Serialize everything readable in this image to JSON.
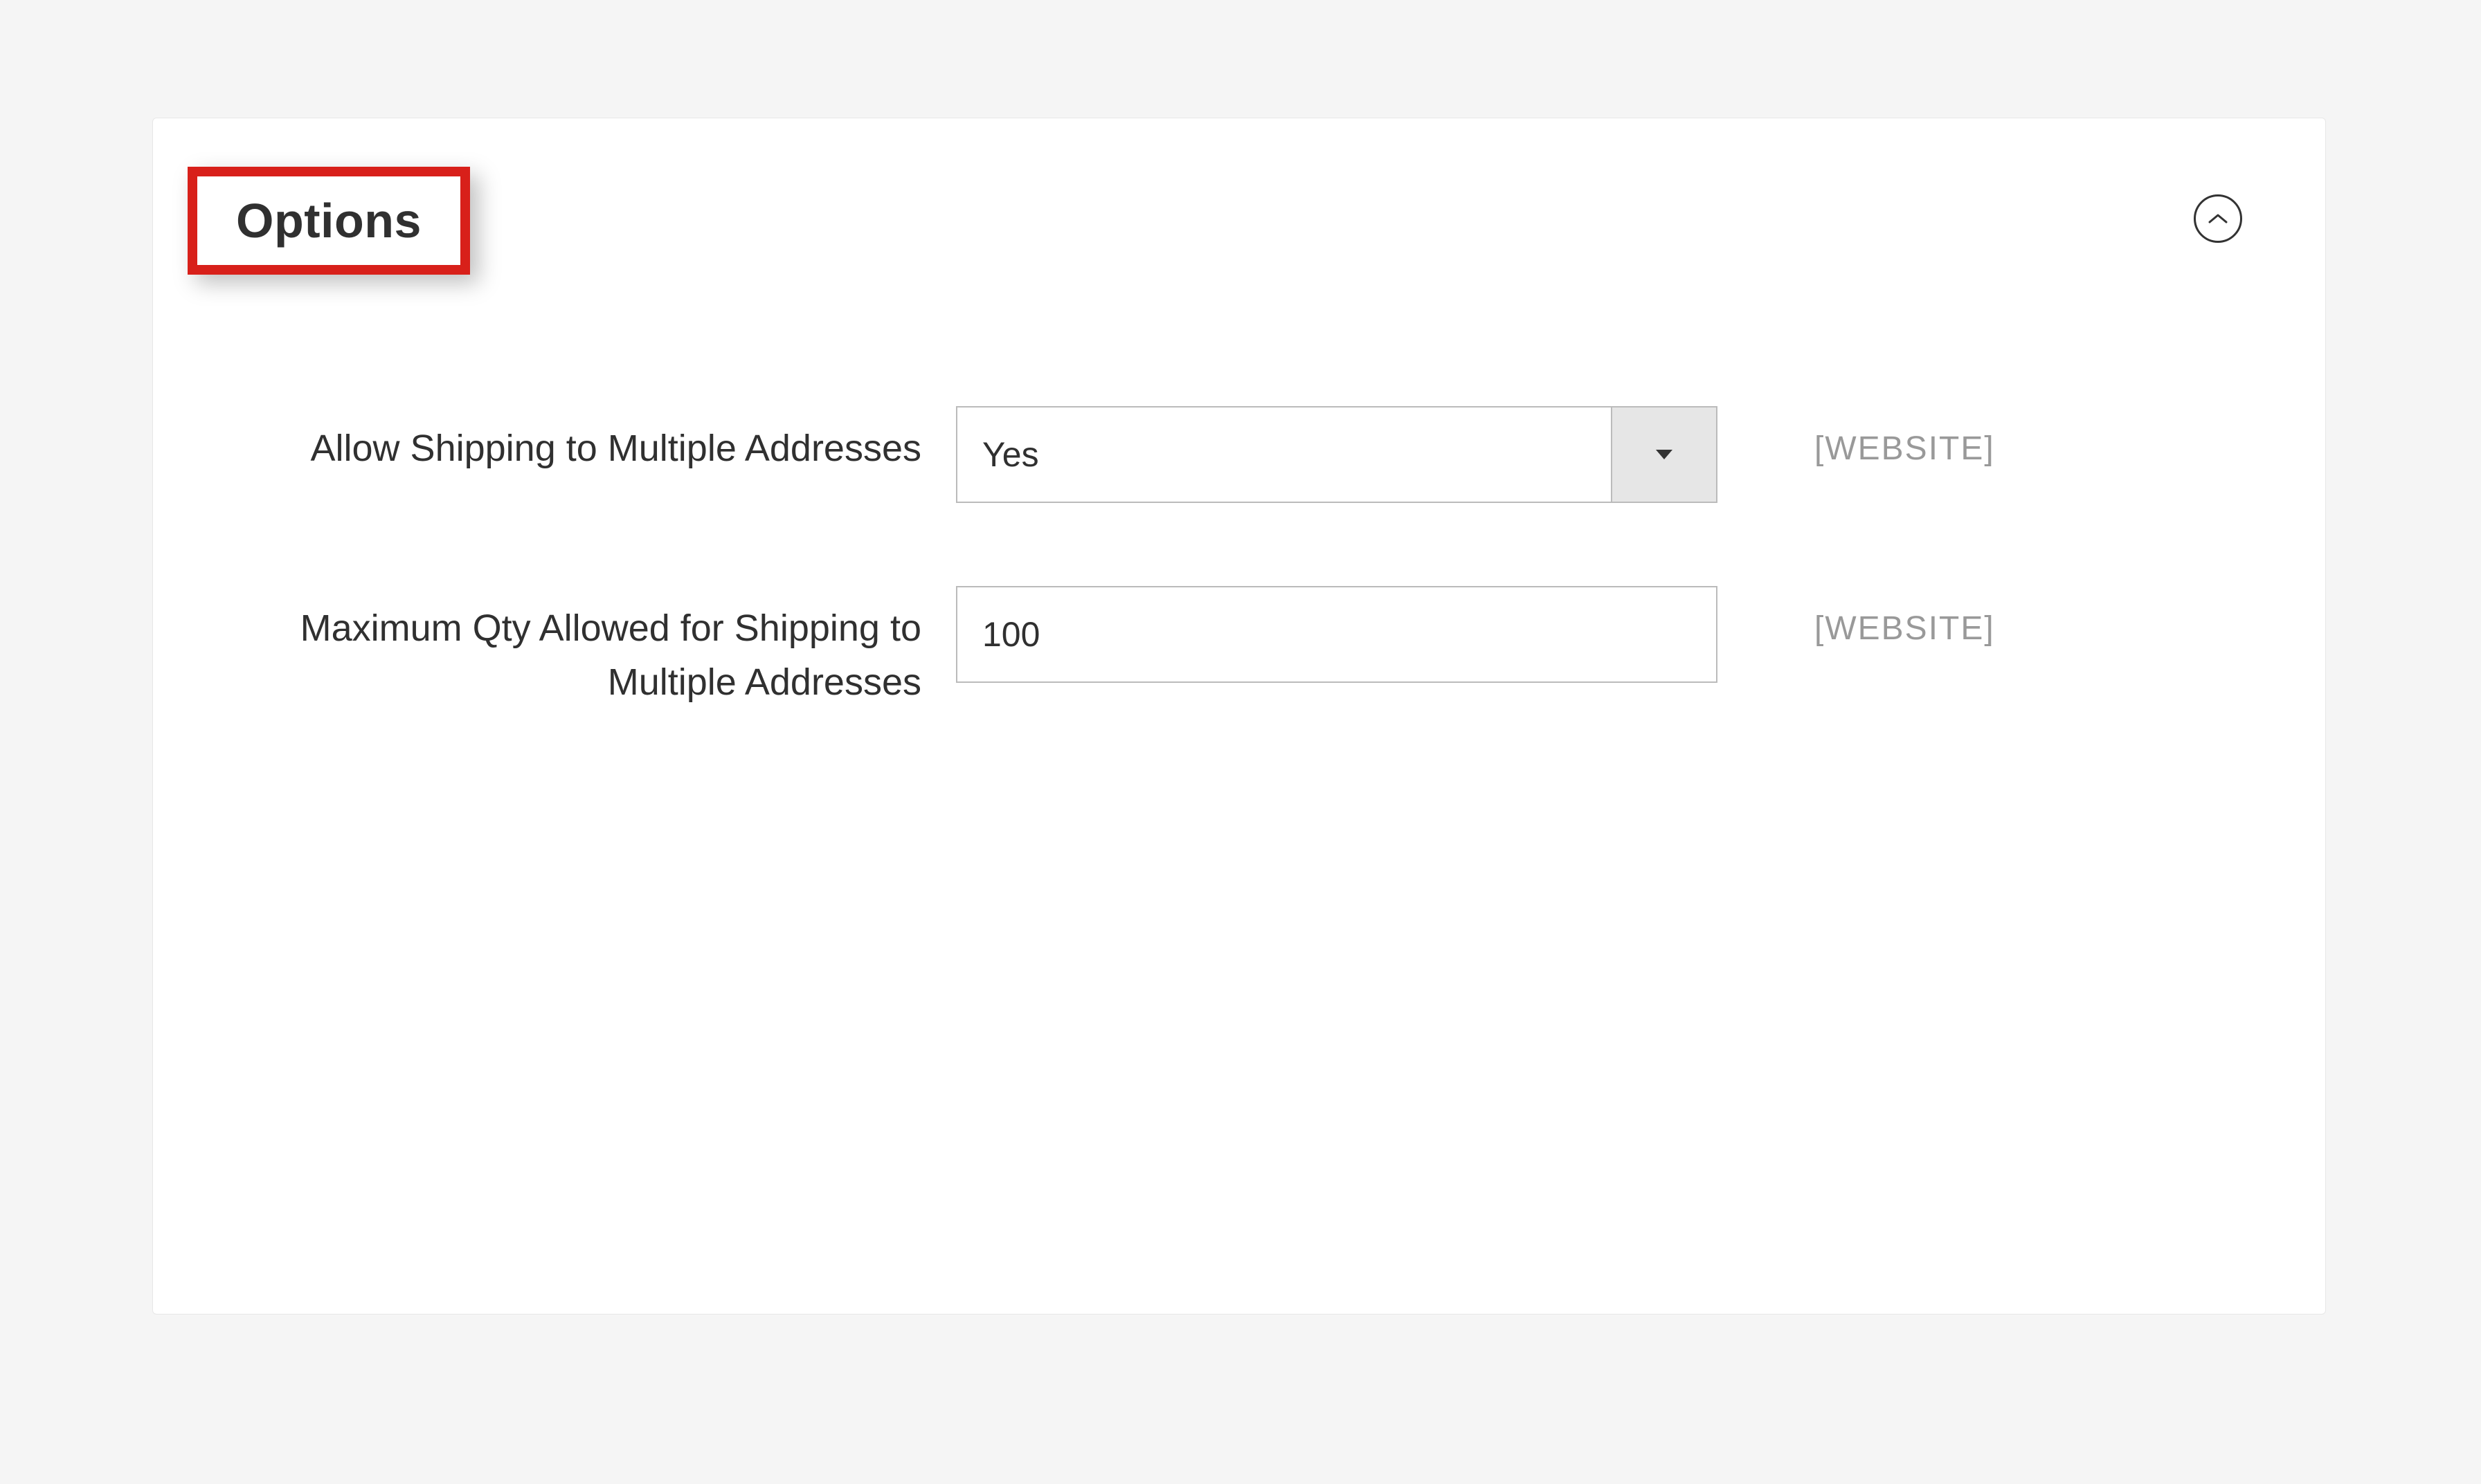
{
  "panel": {
    "title": "Options",
    "fields": {
      "allow_multi": {
        "label": "Allow Shipping to Multiple Addresses",
        "value": "Yes",
        "scope": "[WEBSITE]"
      },
      "max_qty": {
        "label": "Maximum Qty Allowed for Shipping to Multiple Addresses",
        "value": "100",
        "scope": "[WEBSITE]"
      }
    }
  }
}
